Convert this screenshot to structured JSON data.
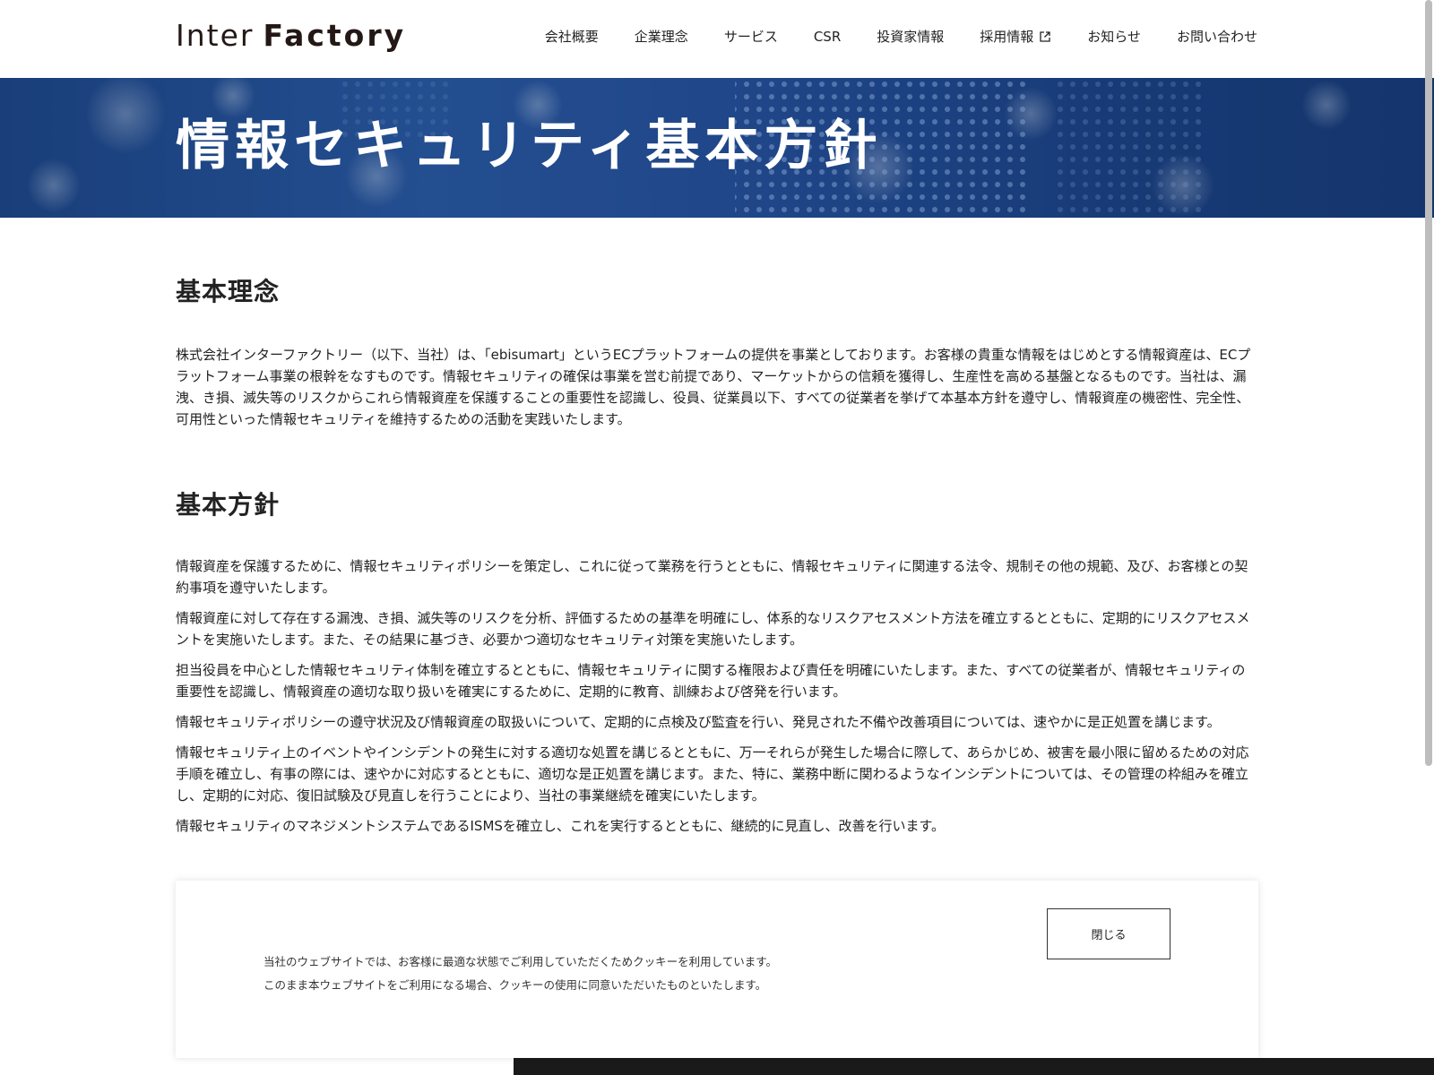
{
  "header": {
    "logo": {
      "inter": "Inter",
      "factory": "Factory"
    },
    "nav": [
      {
        "label": "会社概要"
      },
      {
        "label": "企業理念"
      },
      {
        "label": "サービス"
      },
      {
        "label": "CSR"
      },
      {
        "label": "投資家情報"
      },
      {
        "label": "採用情報",
        "icon": "external-link-icon"
      },
      {
        "label": "お知らせ"
      },
      {
        "label": "お問い合わせ"
      }
    ]
  },
  "hero": {
    "title": "情報セキュリティ基本方針"
  },
  "sections": {
    "philosophy": {
      "heading": "基本理念",
      "body": "株式会社インターファクトリー（以下、当社）は、「ebisumart」というECプラットフォームの提供を事業としております。お客様の貴重な情報をはじめとする情報資産は、ECプラットフォーム事業の根幹をなすものです。情報セキュリティの確保は事業を営む前提であり、マーケットからの信頼を獲得し、生産性を高める基盤となるものです。当社は、漏洩、き損、滅失等のリスクからこれら情報資産を保護することの重要性を認識し、役員、従業員以下、すべての従業者を挙げて本基本方針を遵守し、情報資産の機密性、完全性、可用性といった情報セキュリティを維持するための活動を実践いたします。"
    },
    "policy": {
      "heading": "基本方針",
      "items": [
        "情報資産を保護するために、情報セキュリティポリシーを策定し、これに従って業務を行うとともに、情報セキュリティに関連する法令、規制その他の規範、及び、お客様との契約事項を遵守いたします。",
        "情報資産に対して存在する漏洩、き損、滅失等のリスクを分析、評価するための基準を明確にし、体系的なリスクアセスメント方法を確立するとともに、定期的にリスクアセスメントを実施いたします。また、その結果に基づき、必要かつ適切なセキュリティ対策を実施いたします。",
        "担当役員を中心とした情報セキュリティ体制を確立するとともに、情報セキュリティに関する権限および責任を明確にいたします。また、すべての従業者が、情報セキュリティの重要性を認識し、情報資産の適切な取り扱いを確実にするために、定期的に教育、訓練および啓発を行います。",
        "情報セキュリティポリシーの遵守状況及び情報資産の取扱いについて、定期的に点検及び監査を行い、発見された不備や改善項目については、速やかに是正処置を講じます。",
        "情報セキュリティ上のイベントやインシデントの発生に対する適切な処置を講じるとともに、万一それらが発生した場合に際して、あらかじめ、被害を最小限に留めるための対応手順を確立し、有事の際には、速やかに対応するとともに、適切な是正処置を講じます。また、特に、業務中断に関わるようなインシデントについては、その管理の枠組みを確立し、定期的に対応、復旧試験及び見直しを行うことにより、当社の事業継続を確実にいたします。",
        "情報セキュリティのマネジメントシステムであるISMSを確立し、これを実行するとともに、継続的に見直し、改善を行います。"
      ]
    }
  },
  "cookie": {
    "line1": "当社のウェブサイトでは、お客様に最適な状態でご利用していただくためクッキーを利用しています。",
    "line2": "このまま本ウェブサイトをご利用になる場合、クッキーの使用に同意いただいたものといたします。",
    "close_label": "閉じる"
  },
  "colors": {
    "hero_blue": "#1d4584",
    "text": "#222222",
    "logo": "#231815"
  }
}
